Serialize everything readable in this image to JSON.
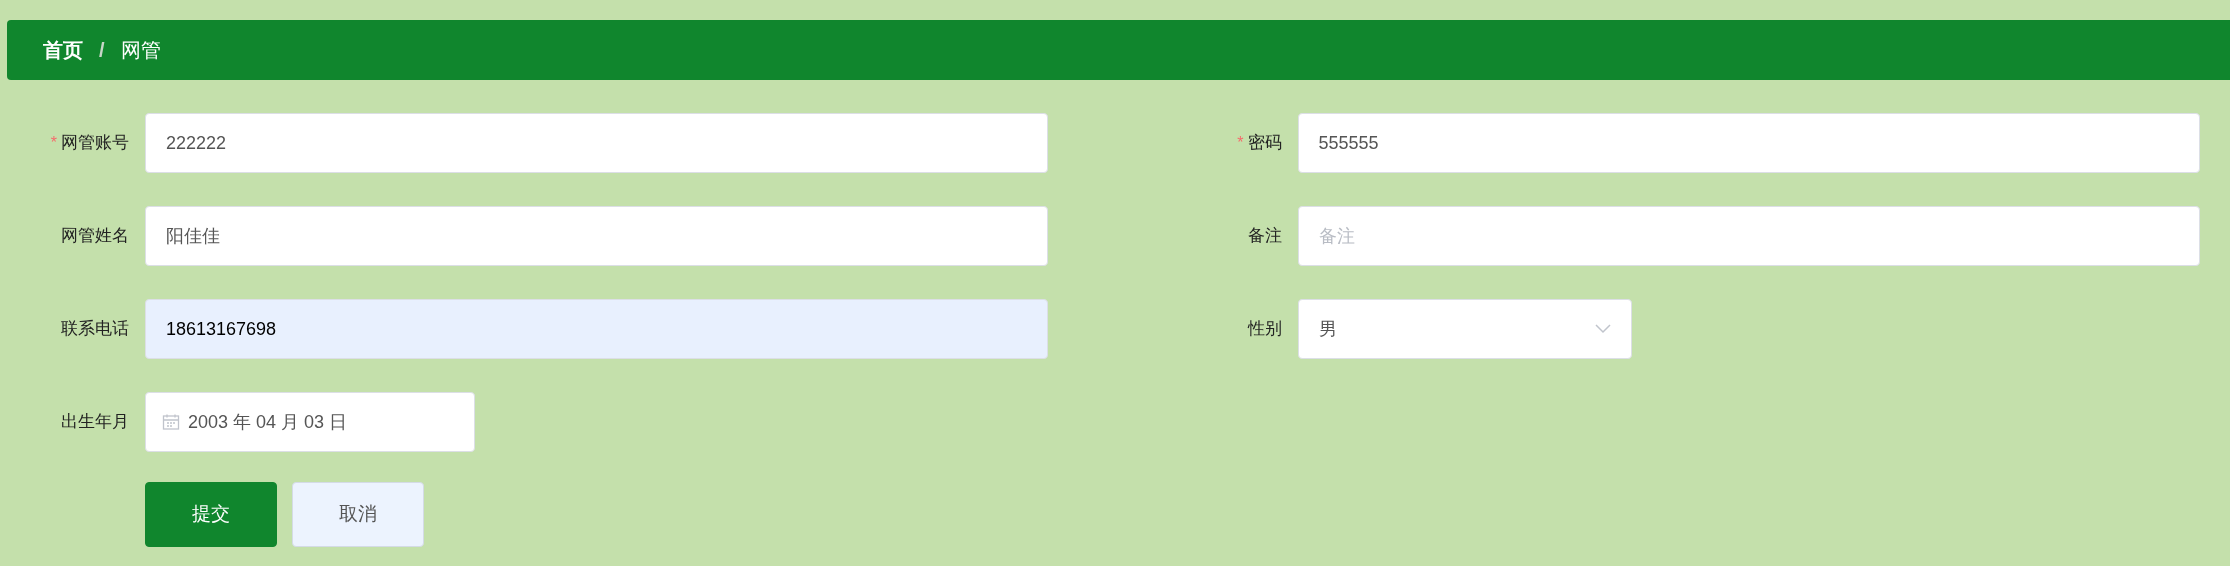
{
  "breadcrumb": {
    "items": [
      {
        "label": "首页",
        "current": false
      },
      {
        "label": "网管",
        "current": true
      }
    ],
    "separator": "/"
  },
  "form": {
    "rows": [
      {
        "fields": [
          {
            "kind": "text",
            "label": "网管账号",
            "required_mark": "*",
            "value": "222222",
            "autofilled": false
          },
          {
            "kind": "text",
            "label": "密码",
            "required_mark": "*",
            "value": "555555",
            "autofilled": false
          }
        ]
      },
      {
        "fields": [
          {
            "kind": "text",
            "label": "网管姓名",
            "value": "阳佳佳",
            "autofilled": false
          },
          {
            "kind": "text",
            "label": "备注",
            "placeholder": "备注",
            "autofilled": false
          }
        ]
      },
      {
        "fields": [
          {
            "kind": "text",
            "label": "联系电话",
            "value": "18613167698",
            "autofilled": true
          },
          {
            "kind": "select",
            "label": "性别",
            "value": "男"
          }
        ]
      },
      {
        "fields": [
          {
            "kind": "date",
            "label": "出生年月",
            "value": "2003 年 04 月 03 日"
          }
        ]
      }
    ],
    "buttons": [
      {
        "label": "提交",
        "kind": "primary"
      },
      {
        "label": "取消",
        "kind": "secondary"
      }
    ]
  }
}
